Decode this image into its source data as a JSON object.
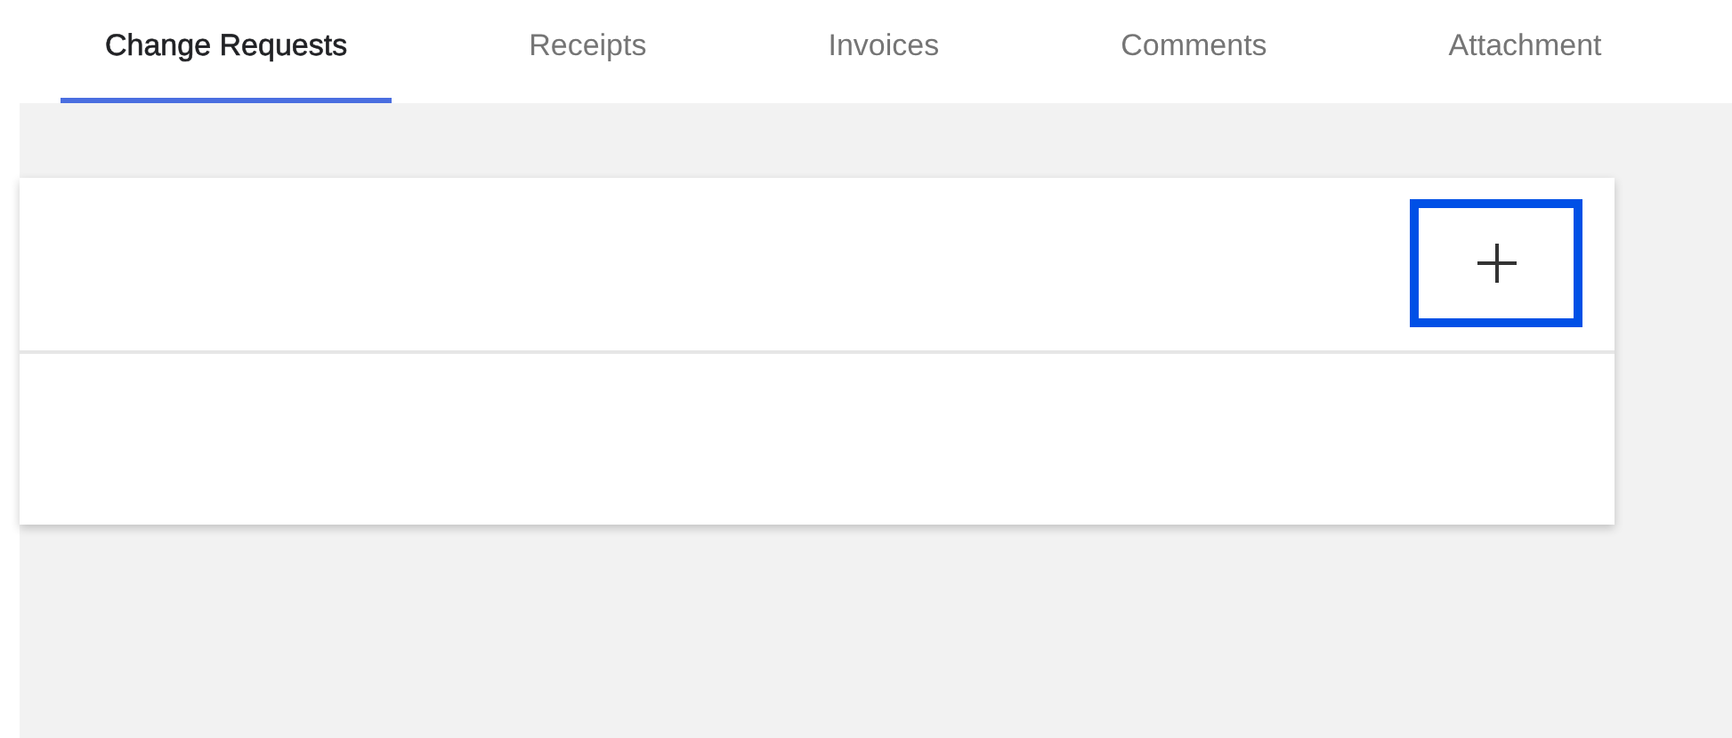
{
  "tabs": [
    {
      "label": "Change Requests",
      "selected": true
    },
    {
      "label": "Receipts",
      "selected": false
    },
    {
      "label": "Invoices",
      "selected": false
    },
    {
      "label": "Comments",
      "selected": false
    },
    {
      "label": "Attachment",
      "selected": false
    }
  ],
  "card": {
    "add_button": {
      "focused": true
    }
  }
}
